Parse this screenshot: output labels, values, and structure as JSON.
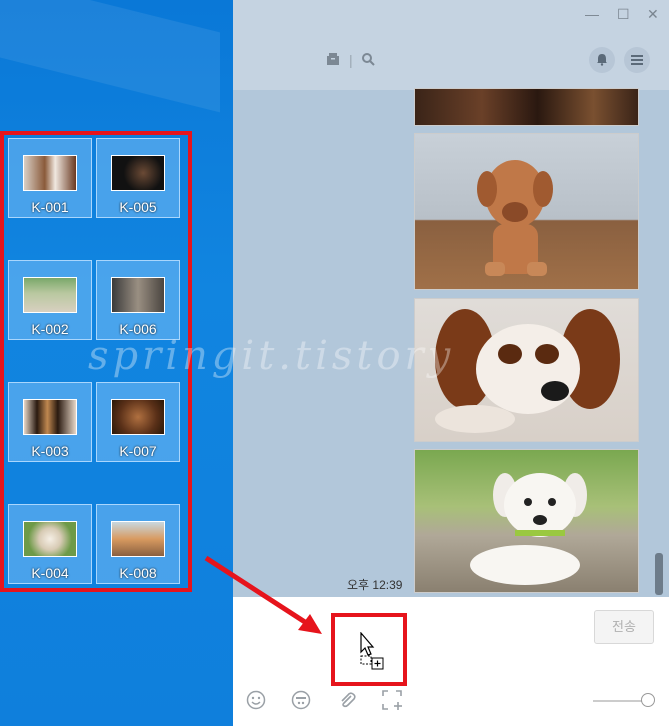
{
  "window": {
    "minimize": "—",
    "maximize": "☐",
    "close": "✕"
  },
  "toolbar": {
    "archive_icon": "archive-icon",
    "search_icon": "search-icon",
    "bell_icon": "bell-icon",
    "menu_icon": "menu-icon"
  },
  "files": [
    {
      "name": "K-001"
    },
    {
      "name": "K-005"
    },
    {
      "name": "K-002"
    },
    {
      "name": "K-006"
    },
    {
      "name": "K-003"
    },
    {
      "name": "K-007"
    },
    {
      "name": "K-004"
    },
    {
      "name": "K-008"
    }
  ],
  "chat": {
    "time": "오후 12:39"
  },
  "input": {
    "send_label": "전송"
  },
  "watermark": "springit.tistory",
  "colors": {
    "annotation": "#e6141c",
    "desktop": "#0a78d7",
    "chat_bg": "#b2c7da"
  }
}
